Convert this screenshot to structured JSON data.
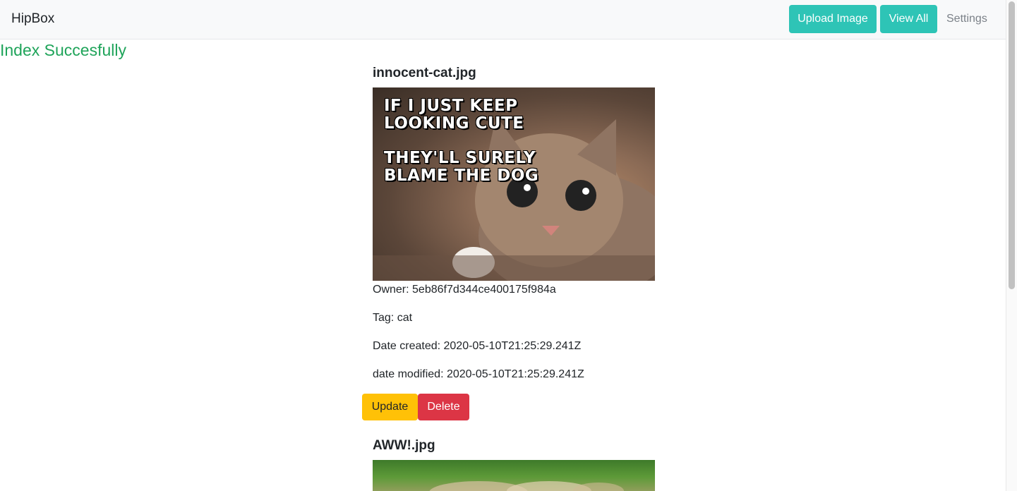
{
  "navbar": {
    "brand": "HipBox",
    "upload_label": "Upload Image",
    "view_all_label": "View All",
    "settings_label": "Settings",
    "accent_color": "#2ec4b6"
  },
  "status_message": "Index Succesfully",
  "images": [
    {
      "filename": "innocent-cat.jpg",
      "meme_top": "IF I JUST KEEP\nLOOKING CUTE",
      "meme_bottom": "THEY'LL SURELY\nBLAME THE DOG",
      "owner": "Owner: 5eb86f7d344ce400175f984a",
      "tag": "Tag: cat",
      "date_created": "Date created: 2020-05-10T21:25:29.241Z",
      "date_modified": "date modified: 2020-05-10T21:25:29.241Z",
      "update_label": "Update",
      "delete_label": "Delete"
    },
    {
      "filename": "AWW!.jpg"
    }
  ],
  "colors": {
    "update": "#ffc107",
    "delete": "#dc3545",
    "status": "#1fa45a"
  }
}
